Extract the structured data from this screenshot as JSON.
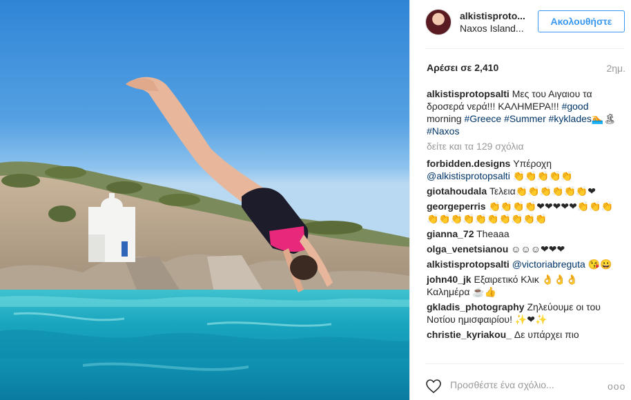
{
  "post": {
    "username": "alkistisproto...",
    "location": "Naxos Island...",
    "follow_label": "Ακολουθήστε",
    "likes": "Αρέσει σε 2,410",
    "time": "2ημ.",
    "caption": {
      "user": "alkistisprotopsalti",
      "text": " Μες του Αιγαιου τα δροσερά νερά!!! ΚΑΛΗΜΕΡΑ!!! ",
      "tag1": "#good",
      "text2": " morning ",
      "tag2": "#Greece",
      "tag3": "#Summer",
      "tag4": "#kyklades",
      "text3": "🏊🏝",
      "tag5": "#Naxos"
    },
    "view_all": "δείτε και τα 129 σχόλια"
  },
  "comments": [
    {
      "user": "forbidden.designs",
      "text": " Υπέροχη ",
      "mention": "@alkistisprotopsalti",
      "text2": " 👏👏👏👏👏"
    },
    {
      "user": "giotahoudala",
      "text": " Τελεια👏👏👏👏👏👏❤",
      "mention": "",
      "text2": ""
    },
    {
      "user": "georgeperris",
      "text": " 👏👏👏👏❤❤❤❤❤👏👏👏👏👏👏👏👏👏👏👏👏👏",
      "mention": "",
      "text2": ""
    },
    {
      "user": "gianna_72",
      "text": " Theaaa",
      "mention": "",
      "text2": ""
    },
    {
      "user": "olga_venetsianou",
      "text": " ☺☺☺❤❤❤",
      "mention": "",
      "text2": ""
    },
    {
      "user": "alkistisprotopsalti",
      "text": " ",
      "mention": "@victoriabreguta",
      "text2": " 😘😀"
    },
    {
      "user": "john40_jk",
      "text": " Εξαιρετικό Κλικ 👌👌👌Καλημέρα ☕👍",
      "mention": "",
      "text2": ""
    },
    {
      "user": "gkladis_photography",
      "text": " Ζηλεύουμε οι του Νοτίου ημισφαιρίου! ✨❤✨",
      "mention": "",
      "text2": ""
    },
    {
      "user": "christie_kyriakou_",
      "text": " Δε υπάρχει πιο",
      "mention": "",
      "text2": ""
    }
  ],
  "footer": {
    "add_comment_placeholder": "Προσθέστε ένα σχόλιο...",
    "more_label": "ooo"
  },
  "colors": {
    "accent": "#3897f0",
    "hashtag": "#003569",
    "muted": "#999999"
  }
}
